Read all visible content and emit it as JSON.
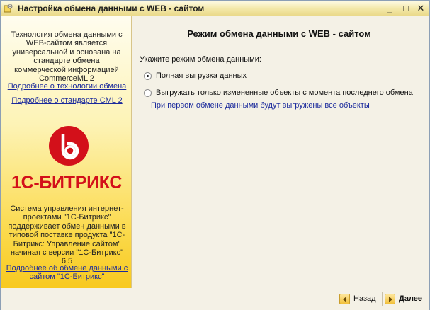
{
  "window": {
    "title": "Настройка обмена данными с WEB - сайтом",
    "icon": "gear-app-icon",
    "controls": {
      "minimize": "_",
      "maximize": "□",
      "close": "✕"
    }
  },
  "left_panel": {
    "description": "Технология обмена данными с WEB-сайтом является универсальной и основана на стандарте обмена коммерческой информацией CommerceML 2",
    "link_technology": "Подробнее о технологии обмена",
    "link_standard": "Подробнее о стандарте CML 2",
    "logo_text": "1С-БИТРИКС",
    "system_text": "Система управления интернет-проектами \"1С-Битрикс\" поддерживает обмен данными в типовой поставке продукта \"1С-Битрикс: Управление сайтом\" начиная с версии \"1С-Битрикс\" 6.5",
    "link_bitrix": "Подробнее об обмене данными с сайтом \"1С-Битрикс\"",
    "colors": {
      "logo_red": "#d3101a",
      "link_blue": "#1b2a9c"
    }
  },
  "main": {
    "title": "Режим обмена данными с WEB - сайтом",
    "prompt": "Укажите режим обмена данными:",
    "options": [
      {
        "label": "Полная выгрузка данных",
        "selected": true
      },
      {
        "label": "Выгружать только измененные объекты с момента последнего обмена",
        "selected": false
      }
    ],
    "note": "При первом обмене данными будут выгружены все объекты"
  },
  "footer": {
    "back_label": "Назад",
    "next_label": "Далее"
  }
}
